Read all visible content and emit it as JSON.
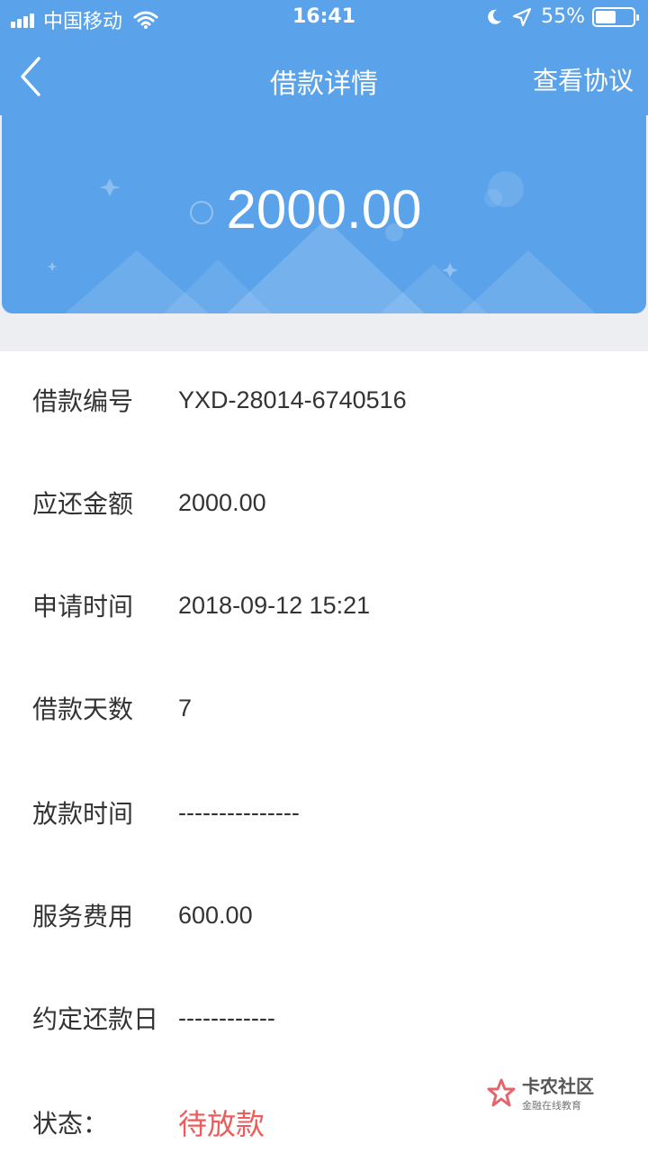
{
  "status_bar": {
    "carrier": "中国移动",
    "time": "16:41",
    "battery_percent": "55%",
    "battery_level": 0.55,
    "icons": [
      "signal-icon",
      "wifi-icon",
      "moon-icon",
      "location-icon",
      "battery-icon"
    ]
  },
  "nav": {
    "title": "借款详情",
    "action_label": "查看协议",
    "back_icon": "chevron-left-icon"
  },
  "hero": {
    "amount": "2000.00"
  },
  "details": {
    "rows": [
      {
        "label": "借款编号",
        "value": "YXD-28014-6740516"
      },
      {
        "label": "应还金额",
        "value": "2000.00"
      },
      {
        "label": "申请时间",
        "value": "2018-09-12 15:21"
      },
      {
        "label": "借款天数",
        "value": "7"
      },
      {
        "label": "放款时间",
        "value": "---------------"
      },
      {
        "label": "服务费用",
        "value": "600.00"
      },
      {
        "label": "约定还款日",
        "value": "------------"
      },
      {
        "label": "状态：",
        "value": "待放款"
      }
    ]
  },
  "watermark": {
    "title": "卡农社区",
    "subtitle": "金融在线教育"
  },
  "colors": {
    "primary": "#5aa2ea",
    "status_pending": "#ef5b5b",
    "page_background": "#edeef2"
  }
}
